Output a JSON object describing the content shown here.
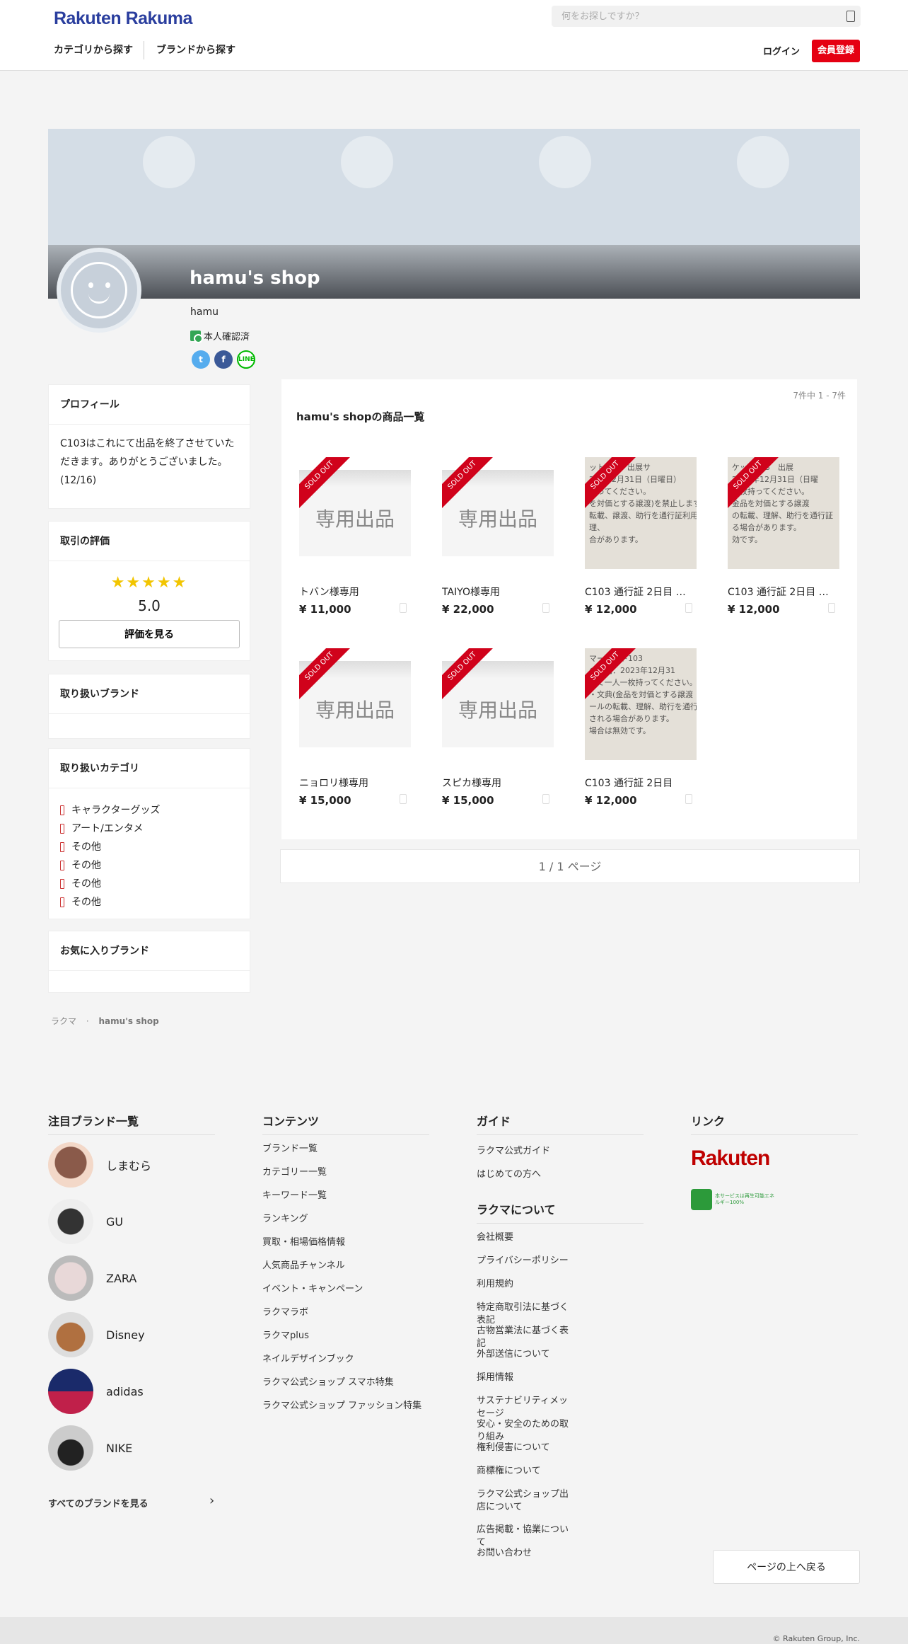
{
  "header": {
    "logo": "Rakuten Rakuma",
    "search_placeholder": "何をお探しですか？",
    "nav_category": "カテゴリから探す",
    "nav_brand": "ブランドから探す",
    "login": "ログイン",
    "signup": "会員登録"
  },
  "shop": {
    "name": "hamu's shop",
    "user": "hamu",
    "verified": "本人確認済"
  },
  "sidebar": {
    "profile_title": "プロフィール",
    "profile_text": "C103はこれにて出品を終了させていただきます。ありがとうございました。(12/16)",
    "rating_title": "取引の評価",
    "stars": "★★★★★",
    "rating_score": "5.0",
    "rating_button": "評価を見る",
    "brands_title": "取り扱いブランド",
    "categories_title": "取り扱いカテゴリ",
    "categories": [
      "キャラクターグッズ",
      "アート/エンタメ",
      "その他",
      "その他",
      "その他",
      "その他"
    ],
    "fav_brands_title": "お気に入りブランド"
  },
  "products": {
    "count": "7件中 1 - 7件",
    "title": "hamu's shopの商品一覧",
    "sold_label": "SOLD OUT",
    "placeholder_text": "専用出品",
    "items": [
      {
        "name": "トバン様専用",
        "price": "¥ 11,000"
      },
      {
        "name": "TAIYO様専用",
        "price": "¥ 22,000"
      },
      {
        "name": "C103 通行証 2日目 コ...",
        "price": "¥ 12,000"
      },
      {
        "name": "C103 通行証 2日目 コ...",
        "price": "¥ 12,000"
      },
      {
        "name": "ニョロリ様専用",
        "price": "¥ 15,000"
      },
      {
        "name": "スピカ様専用",
        "price": "¥ 15,000"
      },
      {
        "name": "C103 通行証 2日目",
        "price": "¥ 12,000"
      }
    ],
    "photo1_lines": [
      "ット103　出展サ",
      "23年12月31日（日曜日）",
      "持ってください。",
      "を対価とする譲渡)を禁止します",
      "転載、譲渡、助行を通行証利用者全員",
      "理、",
      "合があります。"
    ],
    "photo2_lines": [
      "ケット103　出展",
      "2023年12月31日（日曜",
      "一枚持ってください。",
      "金品を対価とする譲渡",
      "の転載、理解、助行を通行証",
      "る場合があります。",
      "効です。"
    ],
    "photo3_lines": [
      "マーケット103",
      "の期間：2023年12月31",
      "して一人一枚持ってください。",
      "・文典(金品を対価とする譲渡",
      "ールの転載、理解、助行を通行",
      "される場合があります。",
      "場合は無効です。"
    ]
  },
  "pager": "1 / 1 ページ",
  "breadcrumb": {
    "home": "ラクマ",
    "current": "hamu's shop"
  },
  "footer": {
    "brands_title": "注目ブランド一覧",
    "brands": [
      "しまむら",
      "GU",
      "ZARA",
      "Disney",
      "adidas",
      "NIKE"
    ],
    "see_all_brands": "すべてのブランドを見る",
    "contents_title": "コンテンツ",
    "contents": [
      "ブランド一覧",
      "カテゴリー一覧",
      "キーワード一覧",
      "ランキング",
      "買取・相場価格情報",
      "人気商品チャンネル",
      "イベント・キャンペーン",
      "ラクマラボ",
      "ラクマplus",
      "ネイルデザインブック",
      "ラクマ公式ショップ スマホ特集",
      "ラクマ公式ショップ ファッション特集"
    ],
    "guide_title": "ガイド",
    "guide": [
      "ラクマ公式ガイド",
      "はじめての方へ"
    ],
    "about_title": "ラクマについて",
    "about": [
      "会社概要",
      "プライバシーポリシー",
      "利用規約",
      "特定商取引法に基づく表記",
      "古物営業法に基づく表記",
      "外部送信について",
      "採用情報",
      "サステナビリティメッセージ",
      "安心・安全のための取り組み",
      "権利侵害について",
      "商標権について",
      "ラクマ公式ショップ出店について",
      "広告掲載・協業について",
      "お問い合わせ"
    ],
    "links_title": "リンク",
    "rakuten_logo": "Rakuten",
    "green_text": "本サービスは再生可能エネルギー100%",
    "back_to_top": "ページの上へ戻る",
    "copyright": "© Rakuten Group, Inc."
  }
}
